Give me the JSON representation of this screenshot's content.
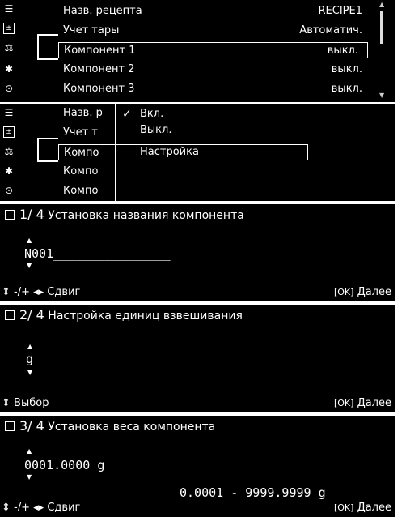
{
  "panel1": {
    "icons": [
      "list-icon",
      "tare-box-icon",
      "scale-component-icon",
      "gear-icon",
      "timer-icon"
    ],
    "rows": [
      {
        "label": "Назв. рецепта",
        "value": "RECIPE1"
      },
      {
        "label": "Учет тары",
        "value": "Автоматич."
      },
      {
        "label": "Компонент 1",
        "value": "выкл."
      },
      {
        "label": "Компонент 2",
        "value": "выкл."
      },
      {
        "label": "Компонент 3",
        "value": "выкл."
      }
    ]
  },
  "panel2": {
    "rows": [
      "Назв. р",
      "Учет т",
      "Компо",
      "Компо",
      "Компо"
    ],
    "dropdown": {
      "items": [
        "Вкл.",
        "Выкл.",
        "Настройка"
      ],
      "checked": "Вкл.",
      "selected": "Настройка"
    }
  },
  "panel3": {
    "step": "1/ 4",
    "title": "Установка названия компонента",
    "value": "N001",
    "underline": "________________",
    "footer_left": "-/+",
    "footer_mid": "Сдвиг",
    "ok_label": "[OK]",
    "next_label": "Далее"
  },
  "panel4": {
    "step": "2/ 4",
    "title": "Настройка единиц взвешивания",
    "unit": "g",
    "footer_left": "Выбор",
    "ok_label": "[OK]",
    "next_label": "Далее"
  },
  "panel5": {
    "step": "3/ 4",
    "title": "Установка веса  компонента",
    "value": "0001.0000",
    "unit": "g",
    "range": "0.0001 - 9999.9999 g",
    "footer_left": "-/+",
    "footer_mid": "Сдвиг",
    "ok_label": "[OK]",
    "next_label": "Далее"
  }
}
